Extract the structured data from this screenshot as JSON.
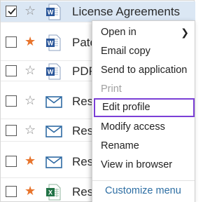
{
  "colors": {
    "selected_row": "#dbe7f4",
    "star_on": "#e8742c",
    "star_off": "#8a8a8a",
    "highlight_border": "#7b3fd6",
    "word_blue": "#2b579a",
    "excel_green": "#217346",
    "link_blue": "#2d6ea3"
  },
  "rows": [
    {
      "checked": true,
      "starred": false,
      "icon": "word-doc-icon",
      "name": "License Agreements"
    },
    {
      "checked": false,
      "starred": true,
      "icon": "word-doc-icon",
      "name": "Pate"
    },
    {
      "checked": false,
      "starred": false,
      "icon": "word-doc-icon",
      "name": "PDR"
    },
    {
      "checked": false,
      "starred": false,
      "icon": "email-icon",
      "name": "Res"
    },
    {
      "checked": false,
      "starred": false,
      "icon": "email-icon",
      "name": "Resi"
    },
    {
      "checked": false,
      "starred": true,
      "icon": "email-icon",
      "name": "Resi"
    },
    {
      "checked": false,
      "starred": true,
      "icon": "excel-doc-icon",
      "name": "Resi"
    }
  ],
  "glyphs": {
    "star": "☆",
    "star_filled": "★",
    "submenu_arrow": "❯"
  },
  "context_menu": {
    "items": [
      {
        "label": "Open in",
        "has_submenu": true
      },
      {
        "label": "Email copy"
      },
      {
        "label": "Send to application"
      },
      {
        "label": "Print",
        "disabled": true
      },
      {
        "label": "Edit profile",
        "highlighted": true
      },
      {
        "label": "Modify access"
      },
      {
        "label": "Rename"
      },
      {
        "label": "View in browser"
      }
    ],
    "footer": "Customize menu"
  }
}
